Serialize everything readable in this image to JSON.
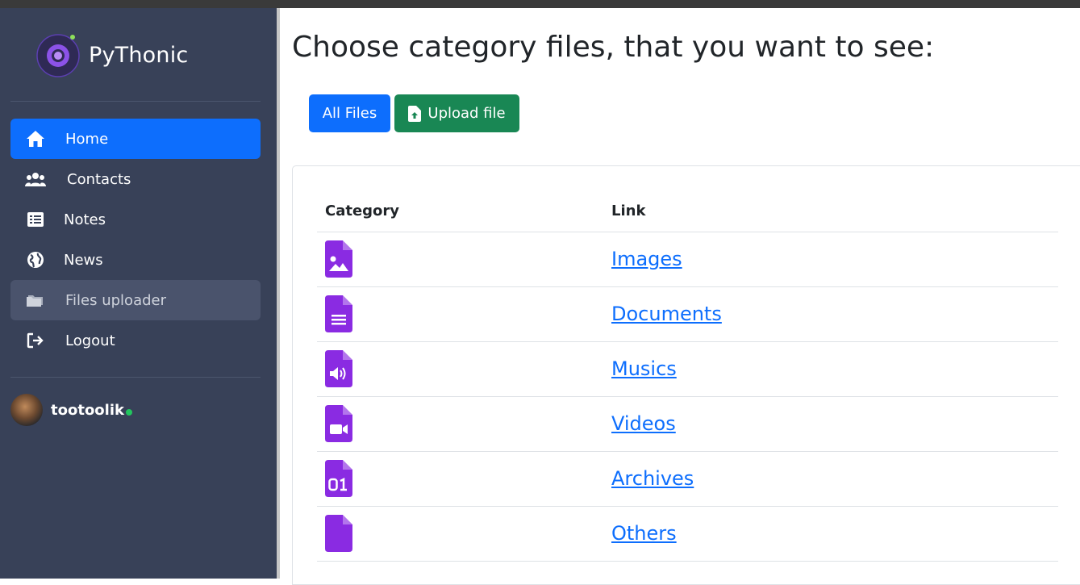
{
  "sidebar": {
    "brand_name": "PyThonic",
    "nav": [
      {
        "label": "Home",
        "icon": "home-icon"
      },
      {
        "label": "Contacts",
        "icon": "users-icon"
      },
      {
        "label": "Notes",
        "icon": "list-icon"
      },
      {
        "label": "News",
        "icon": "globe-icon"
      },
      {
        "label": "Files uploader",
        "icon": "folder-icon"
      },
      {
        "label": "Logout",
        "icon": "logout-icon"
      }
    ],
    "user": {
      "name": "tootoolik",
      "status": "online"
    }
  },
  "main": {
    "title": "Choose category files, that you want to see:",
    "buttons": {
      "all_files": "All Files",
      "upload_file": "Upload file"
    },
    "table": {
      "headers": {
        "category": "Category",
        "link": "Link"
      },
      "rows": [
        {
          "icon": "file-image-icon",
          "link": "Images"
        },
        {
          "icon": "file-text-icon",
          "link": "Documents"
        },
        {
          "icon": "file-audio-icon",
          "link": "Musics"
        },
        {
          "icon": "file-video-icon",
          "link": "Videos"
        },
        {
          "icon": "file-binary-icon",
          "link": "Archives"
        },
        {
          "icon": "file-icon",
          "link": "Others"
        }
      ]
    }
  },
  "colors": {
    "sidebar_bg": "#384158",
    "primary": "#0d6efd",
    "success": "#198754",
    "file_icon": "#8a2be2",
    "online": "#22c55e"
  }
}
